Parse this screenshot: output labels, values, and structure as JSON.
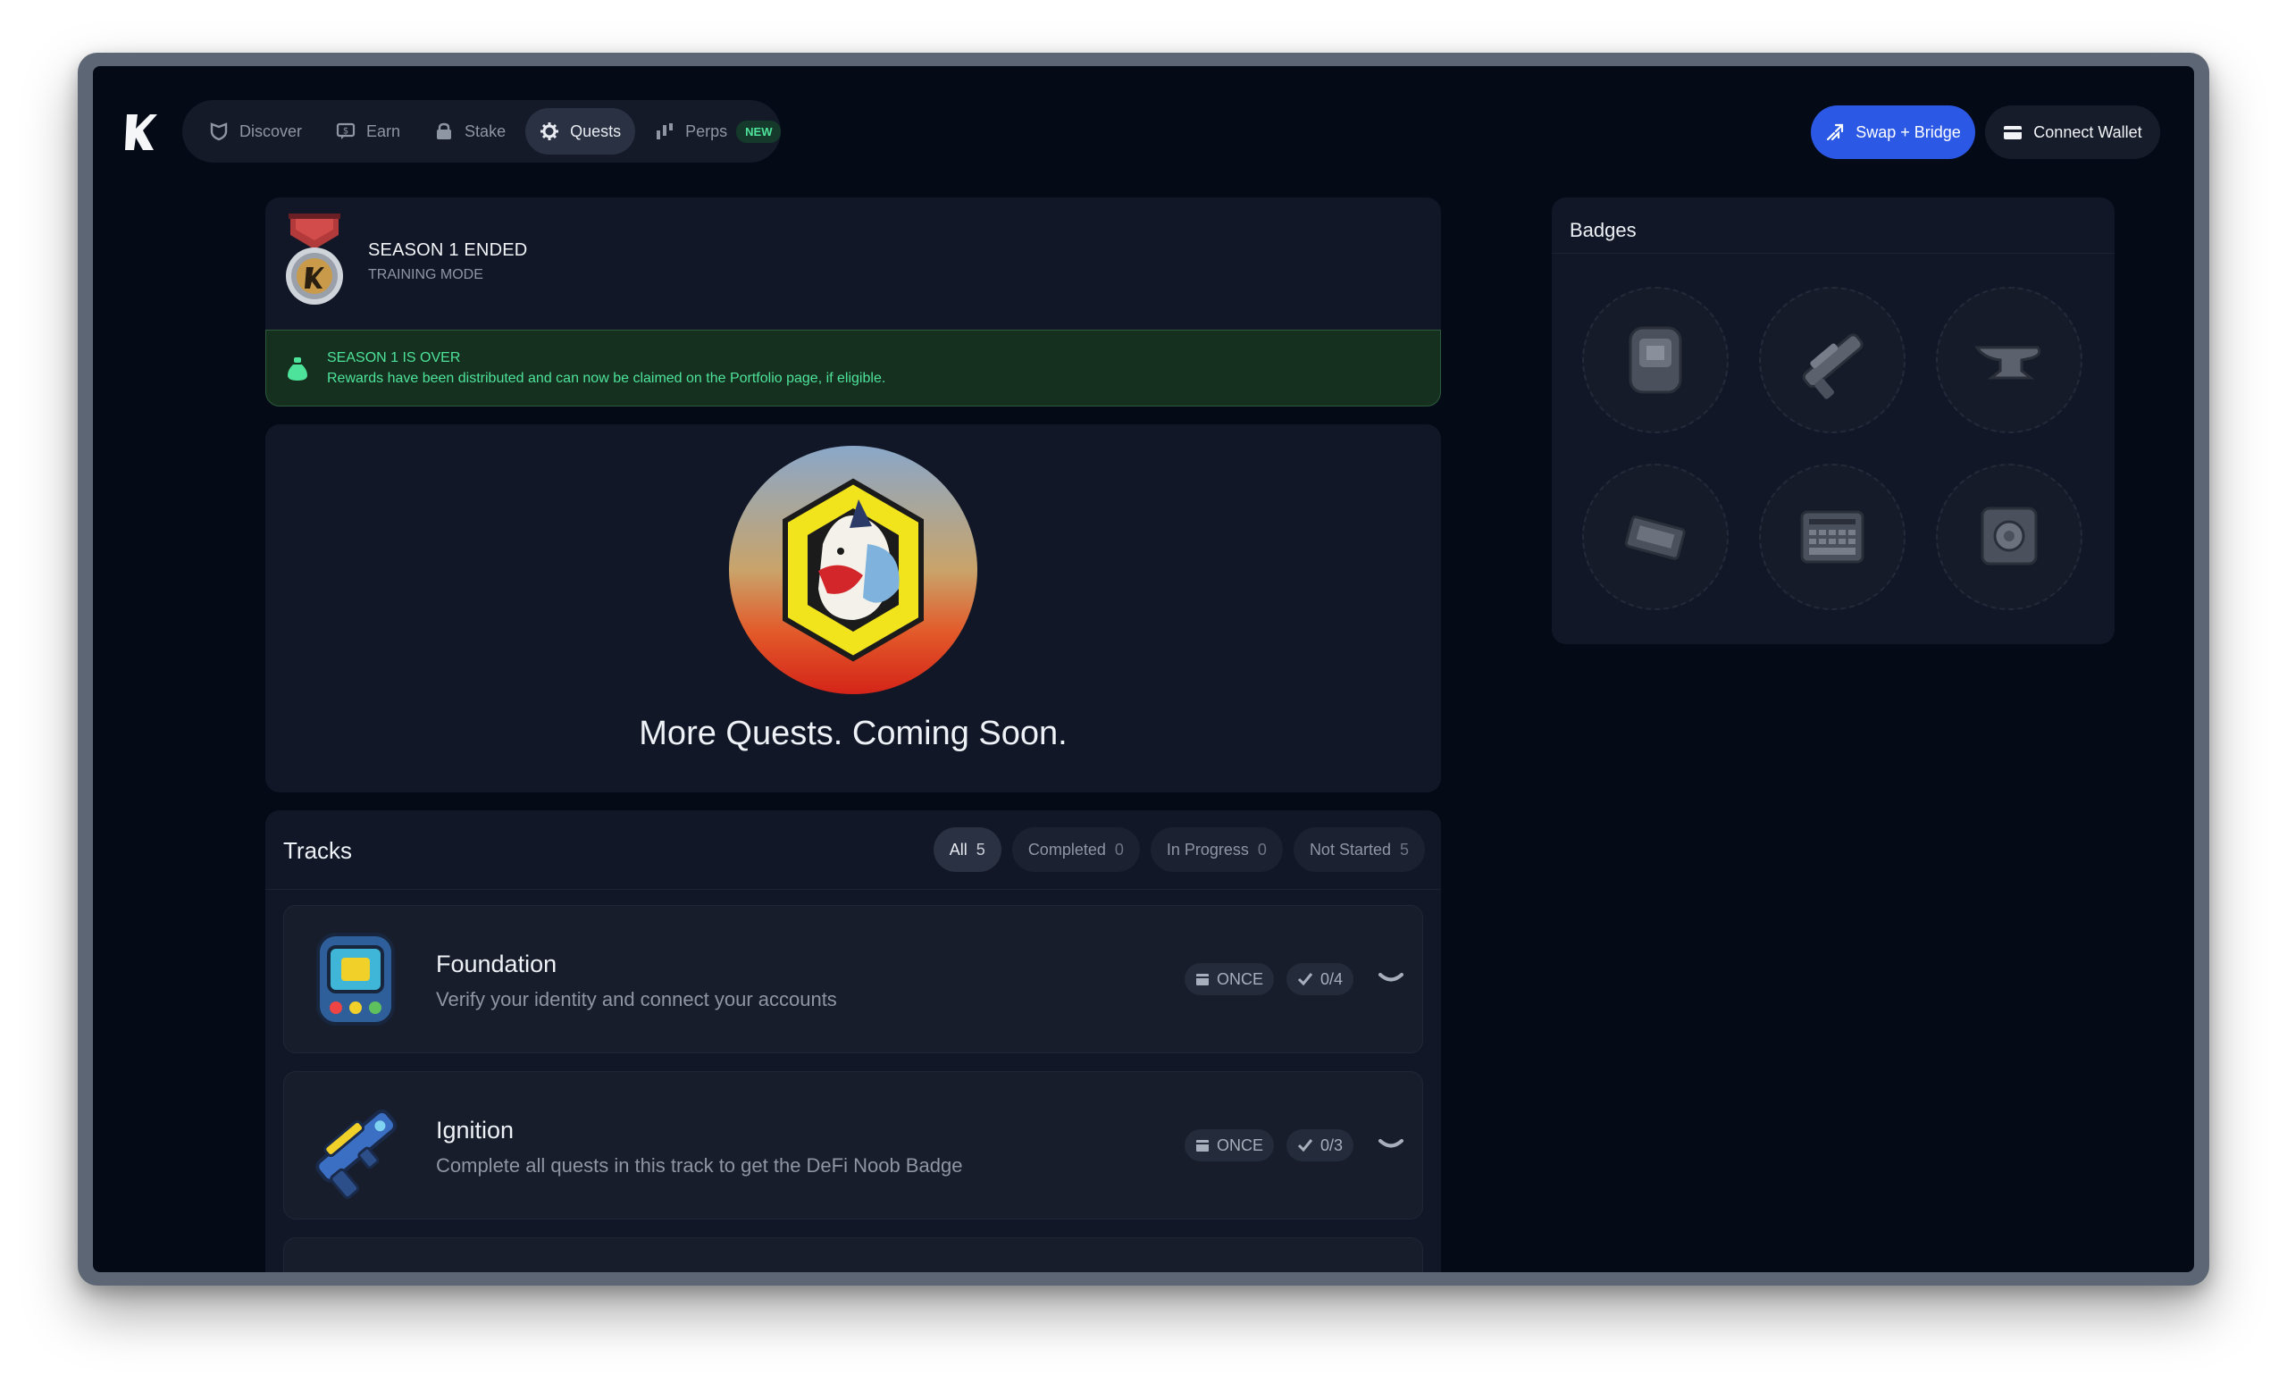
{
  "nav": {
    "items": [
      {
        "label": "Discover",
        "icon": "shield-icon"
      },
      {
        "label": "Earn",
        "icon": "chat-dollar-icon"
      },
      {
        "label": "Stake",
        "icon": "lock-icon"
      },
      {
        "label": "Quests",
        "icon": "gear-icon",
        "active": true
      },
      {
        "label": "Perps",
        "icon": "bars-icon"
      }
    ],
    "new_badge": "NEW"
  },
  "header": {
    "swap_label": "Swap + Bridge",
    "wallet_label": "Connect Wallet"
  },
  "season": {
    "title": "SEASON 1 ENDED",
    "subtitle": "TRAINING MODE",
    "alert_title": "SEASON 1 IS OVER",
    "alert_text": "Rewards have been distributed and can now be claimed on the Portfolio page, if eligible."
  },
  "coming_soon": {
    "text": "More Quests. Coming Soon."
  },
  "tracks": {
    "title": "Tracks",
    "filters": [
      {
        "label": "All",
        "count": "5",
        "active": true
      },
      {
        "label": "Completed",
        "count": "0"
      },
      {
        "label": "In Progress",
        "count": "0"
      },
      {
        "label": "Not Started",
        "count": "5"
      }
    ],
    "items": [
      {
        "name": "Foundation",
        "description": "Verify your identity and connect your accounts",
        "frequency": "ONCE",
        "progress": "0/4",
        "icon": "wrist-device-icon"
      },
      {
        "name": "Ignition",
        "description": "Complete all quests in this track to get the DeFi Noob Badge",
        "frequency": "ONCE",
        "progress": "0/3",
        "icon": "blaster-icon"
      }
    ]
  },
  "badges": {
    "title": "Badges",
    "items": [
      "wrist-device-icon",
      "blaster-icon",
      "anvil-icon",
      "chip-icon",
      "keyboard-icon",
      "safe-icon"
    ]
  },
  "colors": {
    "background": "#050a17",
    "card": "#111726",
    "accent_blue": "#2b59e6",
    "success_green": "#4ee39a"
  }
}
